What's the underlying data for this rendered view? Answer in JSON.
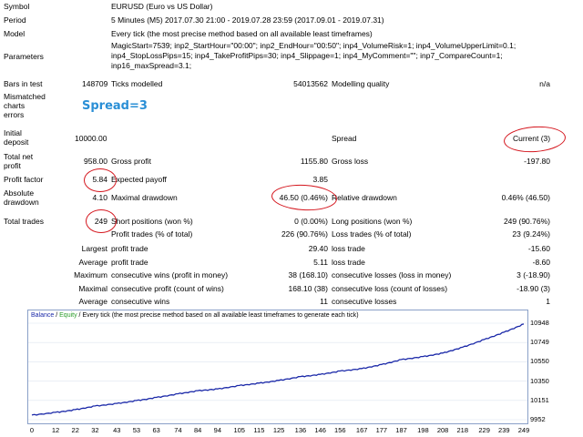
{
  "report": {
    "symbol_label": "Symbol",
    "symbol_value": "EURUSD (Euro vs US Dollar)",
    "period_label": "Period",
    "period_value": "5 Minutes (M5) 2017.07.30 21:00 - 2019.07.28 23:59 (2017.09.01 - 2019.07.31)",
    "model_label": "Model",
    "model_value": "Every tick (the most precise method based on all available least timeframes)",
    "parameters_label": "Parameters",
    "parameters_lines": [
      "MagicStart=7539; inp2_StartHour=\"00:00\"; inp2_EndHour=\"00:50\"; inp4_VolumeRisk=1; inp4_VolumeUpperLimit=0.1;",
      "inp4_StopLossPips=15; inp4_TakeProfitPips=30; inp4_Slippage=1; inp4_MyComment=\"\"; inp7_CompareCount=1;",
      "inp16_maxSpread=3.1;"
    ],
    "bars_label": "Bars in test",
    "bars_value": "148709",
    "ticks_label": "Ticks modelled",
    "ticks_value": "54013562",
    "quality_label": "Modelling quality",
    "quality_value": "n/a",
    "mismatched_label": [
      "Mismatched",
      "charts",
      "errors"
    ],
    "spread_note": "Spread=3",
    "deposit_label": [
      "Initial",
      "deposit"
    ],
    "deposit_value": "10000.00",
    "spread_label": "Spread",
    "spread_value": "Current (3)",
    "net_label": [
      "Total net",
      "profit"
    ],
    "net_value": "958.00",
    "gross_profit_label": "Gross profit",
    "gross_profit_value": "1155.80",
    "gross_loss_label": "Gross loss",
    "gross_loss_value": "-197.80",
    "pf_label": "Profit factor",
    "pf_value": "5.84",
    "payoff_label": "Expected payoff",
    "payoff_value": "3.85",
    "abs_dd_label": [
      "Absolute",
      "drawdown"
    ],
    "abs_dd_value": "4.10",
    "max_dd_label": "Maximal drawdown",
    "max_dd_value": "46.50 (0.46%)",
    "rel_dd_label": "Relative drawdown",
    "rel_dd_value": "0.46% (46.50)",
    "trades_label": "Total trades",
    "trades_value": "249",
    "short_label": "Short positions (won %)",
    "short_value": "0 (0.00%)",
    "long_label": "Long positions (won %)",
    "long_value": "249 (90.76%)",
    "pt_label": "Profit trades (% of total)",
    "pt_value": "226 (90.76%)",
    "lt_label": "Loss trades (% of total)",
    "lt_value": "23 (9.24%)",
    "largest_label": "Largest",
    "largest_profit_label": "profit trade",
    "largest_profit_value": "29.40",
    "largest_loss_label": "loss trade",
    "largest_loss_value": "-15.60",
    "average_label": "Average",
    "average_profit_label": "profit trade",
    "average_profit_value": "5.11",
    "average_loss_label": "loss trade",
    "average_loss_value": "-8.60",
    "maximum_label": "Maximum",
    "max_cw_label": "consecutive wins (profit in money)",
    "max_cw_value": "38 (168.10)",
    "max_cl_label": "consecutive losses (loss in money)",
    "max_cl_value": "3 (-18.90)",
    "maximal_label": "Maximal",
    "mxl_cp_label": "consecutive profit (count of wins)",
    "mxl_cp_value": "168.10 (38)",
    "mxl_cl_label": "consecutive loss (count of losses)",
    "mxl_cl_value": "-18.90 (3)",
    "avg2_label": "Average",
    "avg_cw_label": "consecutive wins",
    "avg_cw_value": "11",
    "avg_cl_label": "consecutive losses",
    "avg_cl_value": "1"
  },
  "chart": {
    "header_balance": "Balance",
    "header_sep1": " / ",
    "header_equity": "Equity",
    "header_rest": " / Every tick (the most precise method based on all available least timeframes to generate each tick)",
    "balance_color": "#1a28a8",
    "equity_color": "#2a9c2a",
    "frame_color": "#8aa0c8"
  },
  "chart_data": {
    "type": "line",
    "yticks": [
      "10948",
      "10749",
      "10550",
      "10350",
      "10151",
      "9952"
    ],
    "ylim": [
      9952,
      10948
    ],
    "xticks": [
      "0",
      "12",
      "22",
      "32",
      "43",
      "53",
      "63",
      "74",
      "84",
      "94",
      "105",
      "115",
      "125",
      "136",
      "146",
      "156",
      "167",
      "177",
      "187",
      "198",
      "208",
      "218",
      "229",
      "239",
      "249"
    ],
    "xlim": [
      0,
      249
    ],
    "series": [
      {
        "name": "Balance",
        "x": [
          0,
          12,
          22,
          32,
          43,
          53,
          63,
          74,
          84,
          94,
          105,
          115,
          125,
          136,
          146,
          156,
          167,
          177,
          187,
          198,
          208,
          218,
          229,
          239,
          249
        ],
        "y": [
          10000,
          10028,
          10056,
          10094,
          10120,
          10150,
          10182,
          10220,
          10252,
          10270,
          10305,
          10330,
          10358,
          10397,
          10420,
          10455,
          10480,
          10522,
          10573,
          10604,
          10640,
          10700,
          10780,
          10855,
          10940
        ]
      }
    ]
  }
}
